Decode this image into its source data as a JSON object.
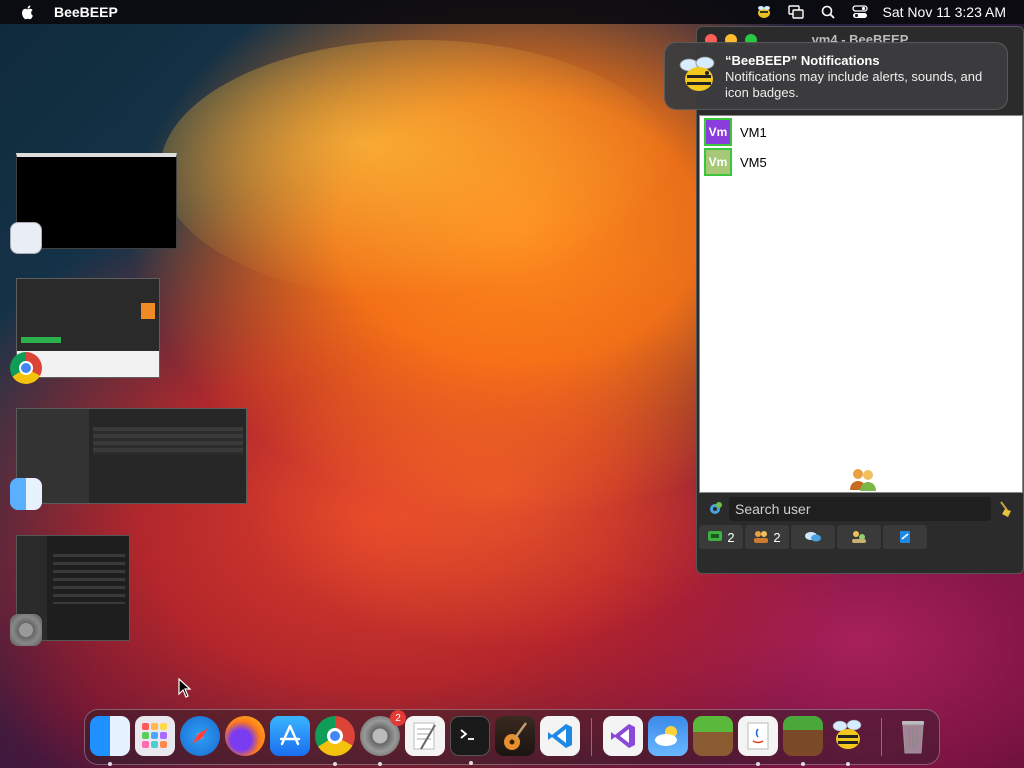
{
  "menubar": {
    "app_name": "BeeBEEP",
    "clock": "Sat Nov 11  3:23 AM"
  },
  "window": {
    "title": "vm4 - BeeBEEP",
    "users": [
      {
        "badge": "Vm",
        "name": "VM1",
        "color": "#8a3cdc"
      },
      {
        "badge": "Vm",
        "name": "VM5",
        "color": "#a8c878"
      }
    ],
    "search_placeholder": "Search user",
    "tabs": [
      {
        "icon": "chat-icon",
        "count": "2"
      },
      {
        "icon": "users-icon",
        "count": "2"
      },
      {
        "icon": "groups-icon",
        "count": ""
      },
      {
        "icon": "contacts-icon",
        "count": ""
      },
      {
        "icon": "file-share-icon",
        "count": ""
      }
    ]
  },
  "notification": {
    "title": "“BeeBEEP” Notifications",
    "body": "Notifications may include alerts, sounds, and icon badges."
  },
  "dock": {
    "settings_badge": "2",
    "items": [
      "finder",
      "launchpad",
      "safari",
      "firefox",
      "app-store",
      "chrome",
      "system-settings",
      "textedit",
      "terminal",
      "garageband",
      "vscode",
      "visual-studio",
      "weather",
      "minecraft-launcher",
      "java",
      "minecraft",
      "beebeep",
      "trash"
    ]
  }
}
